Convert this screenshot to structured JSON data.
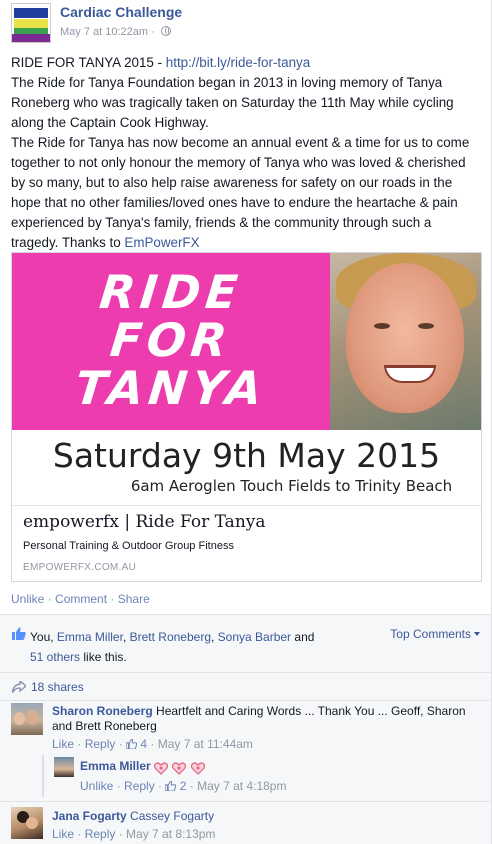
{
  "post": {
    "page_name": "Cardiac Challenge",
    "timestamp": "May 7 at 10:22am",
    "meta_separator": "·",
    "text_prefix": "RIDE FOR TANYA 2015 - ",
    "url": "http://bit.ly/ride-for-tanya",
    "para1": "The Ride for Tanya Foundation began in 2013 in loving memory of Tanya Roneberg who was tragically taken on Saturday the 11th May while cycling along the Captain Cook Highway.",
    "para2_prefix": "The Ride for Tanya has now become an annual event & a time for us to come together to not only honour the memory of Tanya who was loved & cherished by so many, but to also help raise awareness for safety on our roads in the hope that no other families/loved ones have to endure the heartache & pain experienced by Tanya's family, friends & the community through such a tragedy. Thanks to ",
    "thanks_link": "EmPowerFX"
  },
  "link_card": {
    "image_line1": "RIDE",
    "image_line2": "FOR",
    "image_line3": "TANYA",
    "image_date": "Saturday 9th May 2015",
    "image_place": "6am Aeroglen Touch Fields to Trinity Beach",
    "title": "empowerfx | Ride For Tanya",
    "description": "Personal Training & Outdoor Group Fitness",
    "domain": "EMPOWERFX.COM.AU"
  },
  "actions": {
    "unlike": "Unlike",
    "comment": "Comment",
    "share": "Share",
    "separator": "·"
  },
  "likes": {
    "you": "You, ",
    "name1": "Emma Miller",
    "comma1": ", ",
    "name2": "Brett Roneberg",
    "comma2": ", ",
    "name3": "Sonya Barber",
    "and": " and",
    "others": "51 others",
    "suffix": " like this.",
    "top_comments": "Top Comments"
  },
  "shares": {
    "label": "18 shares"
  },
  "comments": [
    {
      "name": "Sharon Roneberg",
      "text": " Heartfelt and Caring Words ... Thank You ... Geoff, Sharon and Brett Roneberg",
      "like": "Like",
      "reply": "Reply",
      "like_count": "4",
      "time": "May 7 at 11:44am"
    },
    {
      "name": "Emma Miller",
      "unlike": "Unlike",
      "reply": "Reply",
      "like_count": "2",
      "time": "May 7 at 4:18pm"
    },
    {
      "name": "Jana Fogarty",
      "tagged": "Cassey Fogarty",
      "like": "Like",
      "reply": "Reply",
      "time": "May 7 at 8:13pm"
    }
  ],
  "colors": {
    "link_blue": "#3b5998",
    "banner_pink": "#ec3cad",
    "heart_pink": "#e0607e"
  }
}
